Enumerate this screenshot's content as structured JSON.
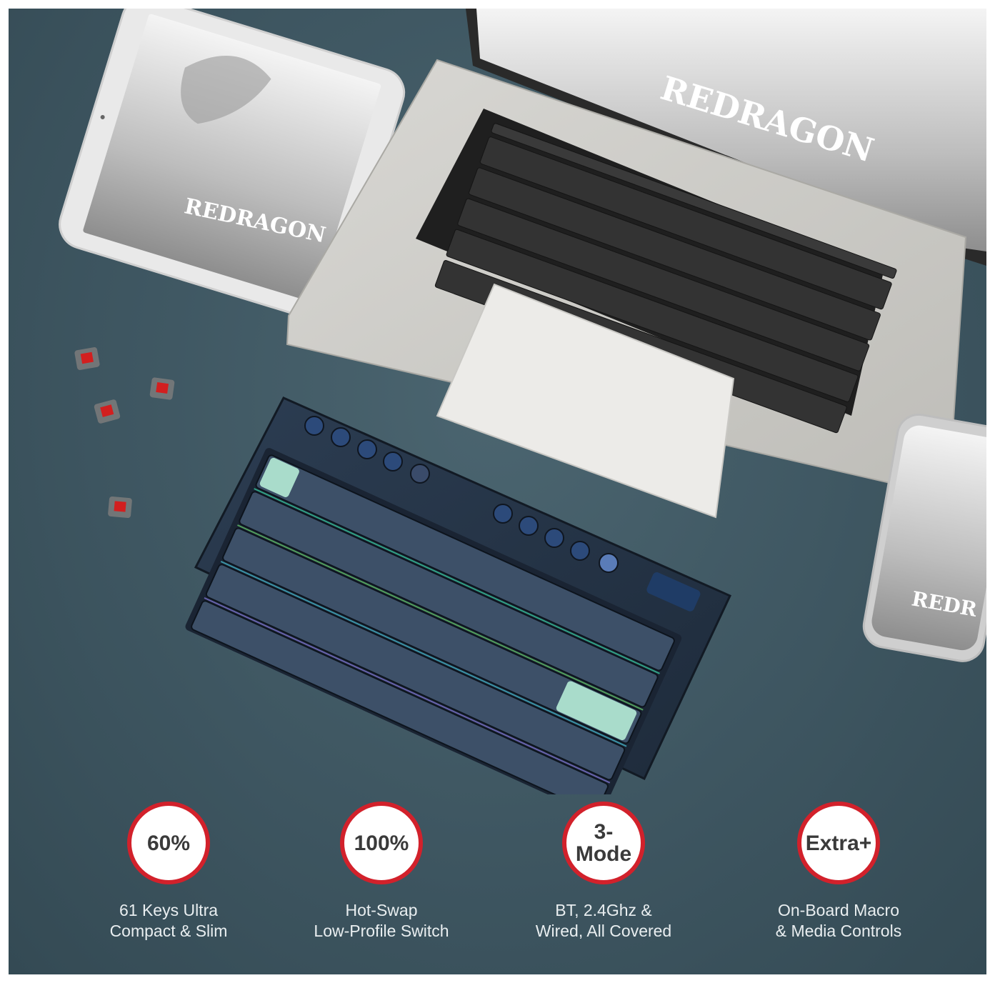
{
  "brand_text": "REDRAGON",
  "colors": {
    "background": "#3e5661",
    "accent_red": "#d2212b",
    "caption_text": "#e9eef0"
  },
  "features": [
    {
      "badge": "60%",
      "caption": "61 Keys Ultra\nCompact & Slim"
    },
    {
      "badge": "100%",
      "caption": "Hot-Swap\nLow-Profile Switch"
    },
    {
      "badge": "3-\nMode",
      "caption": "BT, 2.4Ghz &\nWired, All Covered"
    },
    {
      "badge": "Extra+",
      "caption": "On-Board Macro\n& Media Controls"
    }
  ]
}
